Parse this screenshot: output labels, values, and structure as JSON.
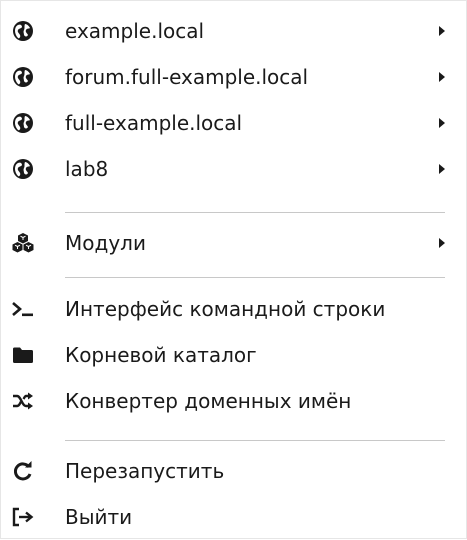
{
  "menu": {
    "items": [
      {
        "label": "example.local",
        "icon": "globe-icon",
        "submenu": true
      },
      {
        "label": "forum.full-example.local",
        "icon": "globe-icon",
        "submenu": true
      },
      {
        "label": "full-example.local",
        "icon": "globe-icon",
        "submenu": true
      },
      {
        "label": "lab8",
        "icon": "globe-icon",
        "submenu": true
      },
      {
        "label": "Модули",
        "icon": "cubes-icon",
        "submenu": true
      },
      {
        "label": "Интерфейс командной строки",
        "icon": "terminal-icon",
        "submenu": false
      },
      {
        "label": "Корневой каталог",
        "icon": "folder-icon",
        "submenu": false
      },
      {
        "label": "Конвертер доменных имён",
        "icon": "shuffle-icon",
        "submenu": false
      },
      {
        "label": "Перезапустить",
        "icon": "redo-icon",
        "submenu": false
      },
      {
        "label": "Выйти",
        "icon": "sign-out-icon",
        "submenu": false
      }
    ]
  },
  "colors": {
    "text": "#1a1a1a",
    "icon": "#1a1a1a",
    "separator": "#c8c8c8",
    "background": "#ffffff"
  }
}
